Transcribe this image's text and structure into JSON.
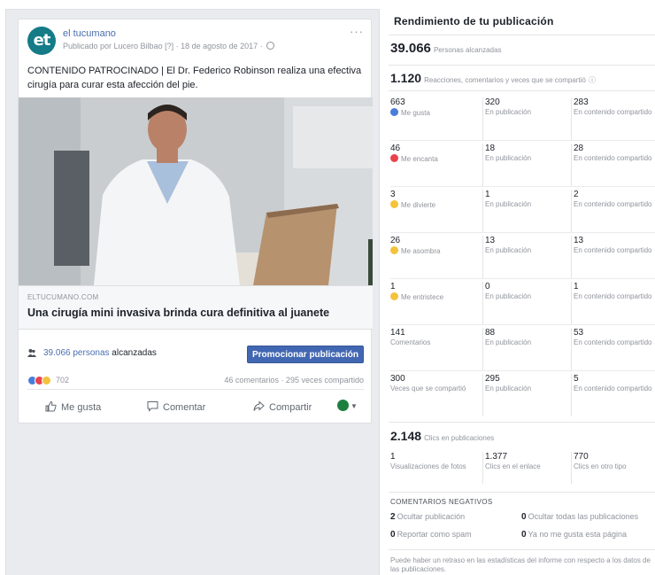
{
  "post": {
    "page_name": "el tucumano",
    "avatar_text": "et",
    "published_by": "Publicado por Lucero Bilbao",
    "date": "18 de agosto de 2017",
    "text": "CONTENIDO PATROCINADO | El Dr. Federico Robinson realiza una efectiva cirugía para curar esta afección del pie.",
    "link_domain": "ELTUCUMANO.COM",
    "link_title": "Una cirugía mini invasiva brinda cura definitiva al juanete",
    "reach_count": "39.066 personas",
    "reach_label": "alcanzadas",
    "promote_label": "Promocionar publicación",
    "reactions_count": "702",
    "comments_shares": "46 comentarios · 295 veces compartido",
    "actions": {
      "like": "Me gusta",
      "comment": "Comentar",
      "share": "Compartir"
    }
  },
  "performance": {
    "title": "Rendimiento de tu publicación",
    "people_reached_num": "39.066",
    "people_reached_label": "Personas alcanzadas",
    "reactions_num": "1.120",
    "reactions_label": "Reacciones, comentarios y veces que se compartió",
    "rows": [
      {
        "c1n": "663",
        "c1l": "Me gusta",
        "icon": "like-icon",
        "color": "#4a7ddb",
        "c2n": "320",
        "c2l": "En publicación",
        "c3n": "283",
        "c3l": "En contenido compartido"
      },
      {
        "c1n": "46",
        "c1l": "Me encanta",
        "icon": "love-icon",
        "color": "#e9424f",
        "c2n": "18",
        "c2l": "En publicación",
        "c3n": "28",
        "c3l": "En contenido compartido"
      },
      {
        "c1n": "3",
        "c1l": "Me divierte",
        "icon": "haha-icon",
        "color": "#f4c23c",
        "c2n": "1",
        "c2l": "En publicación",
        "c3n": "2",
        "c3l": "En contenido compartido"
      },
      {
        "c1n": "26",
        "c1l": "Me asombra",
        "icon": "wow-icon",
        "color": "#f4c23c",
        "c2n": "13",
        "c2l": "En publicación",
        "c3n": "13",
        "c3l": "En contenido compartido"
      },
      {
        "c1n": "1",
        "c1l": "Me entristece",
        "icon": "sad-icon",
        "color": "#f4c23c",
        "c2n": "0",
        "c2l": "En publicación",
        "c3n": "1",
        "c3l": "En contenido compartido"
      },
      {
        "c1n": "141",
        "c1l": "Comentarios",
        "icon": "",
        "color": "",
        "c2n": "88",
        "c2l": "En publicación",
        "c3n": "53",
        "c3l": "En contenido compartido"
      },
      {
        "c1n": "300",
        "c1l": "Veces que se compartió",
        "icon": "",
        "color": "",
        "c2n": "295",
        "c2l": "En publicación",
        "c3n": "5",
        "c3l": "En contenido compartido"
      }
    ],
    "clicks_num": "2.148",
    "clicks_label": "Clics en publicaciones",
    "clicks": {
      "c1n": "1",
      "c1l": "Visualizaciones de fotos",
      "c2n": "1.377",
      "c2l": "Clics en el enlace",
      "c3n": "770",
      "c3l": "Clics en otro tipo"
    },
    "negative_title": "COMENTARIOS NEGATIVOS",
    "negative": {
      "hide_post_num": "2",
      "hide_post": "Ocultar publicación",
      "hide_all_num": "0",
      "hide_all": "Ocultar todas las publicaciones",
      "spam_num": "0",
      "spam": "Reportar como spam",
      "unlike_num": "0",
      "unlike": "Ya no me gusta esta página"
    },
    "footer": "Puede haber un retraso en las estadísticas del informe con respecto a los datos de las publicaciones."
  }
}
